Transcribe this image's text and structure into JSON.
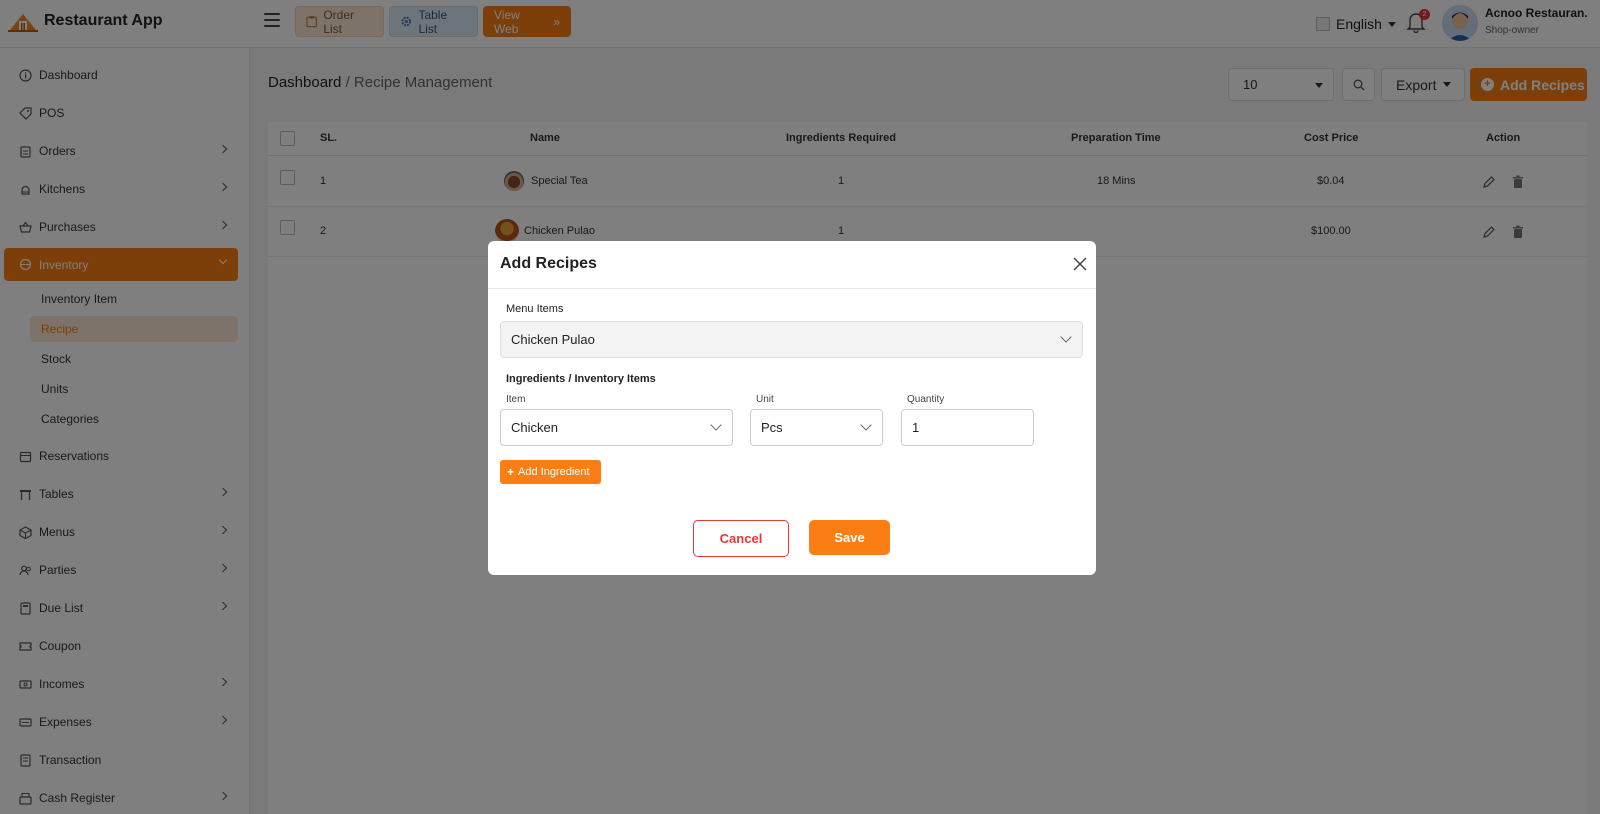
{
  "app": {
    "name": "Restaurant App"
  },
  "topbar": {
    "order_list": "Order List",
    "table_list": "Table List",
    "view_web": "View Web",
    "language": "English",
    "notification_count": "2",
    "user_name": "Acnoo Restauran.",
    "user_role": "Shop-owner"
  },
  "sidebar": {
    "items": [
      {
        "label": "Dashboard",
        "icon": "info-icon"
      },
      {
        "label": "POS",
        "icon": "tag-icon"
      },
      {
        "label": "Orders",
        "icon": "clipboard-icon"
      },
      {
        "label": "Kitchens",
        "icon": "chef-icon"
      },
      {
        "label": "Purchases",
        "icon": "basket-icon"
      },
      {
        "label": "Inventory",
        "icon": "box-icon"
      },
      {
        "label": "Reservations",
        "icon": "calendar-icon"
      },
      {
        "label": "Tables",
        "icon": "table-icon"
      },
      {
        "label": "Menus",
        "icon": "cube-icon"
      },
      {
        "label": "Parties",
        "icon": "users-icon"
      },
      {
        "label": "Due List",
        "icon": "calculator-icon"
      },
      {
        "label": "Coupon",
        "icon": "ticket-icon"
      },
      {
        "label": "Incomes",
        "icon": "income-icon"
      },
      {
        "label": "Expenses",
        "icon": "expense-icon"
      },
      {
        "label": "Transaction",
        "icon": "receipt-icon"
      },
      {
        "label": "Cash Register",
        "icon": "register-icon"
      }
    ],
    "inventory_sub": [
      "Inventory Item",
      "Recipe",
      "Stock",
      "Units",
      "Categories"
    ]
  },
  "main": {
    "breadcrumb_root": "Dashboard",
    "breadcrumb_current": "/ Recipe Management",
    "per_page": "10",
    "export_label": "Export",
    "add_label": "Add Recipes"
  },
  "table": {
    "headers": [
      "SL.",
      "Name",
      "Ingredients Required",
      "Preparation Time",
      "Cost Price",
      "Action"
    ],
    "rows": [
      {
        "sl": "1",
        "name": "Special Tea",
        "ingredients": "1",
        "prep_time": "18 Mins",
        "cost": "$0.04"
      },
      {
        "sl": "2",
        "name": "Chicken Pulao",
        "ingredients": "1",
        "prep_time": "",
        "cost": "$100.00"
      }
    ]
  },
  "modal": {
    "title": "Add Recipes",
    "menu_items_label": "Menu Items",
    "menu_item_value": "Chicken Pulao",
    "ingredients_heading": "Ingredients / Inventory Items",
    "item_label": "Item",
    "item_value": "Chicken",
    "unit_label": "Unit",
    "unit_value": "Pcs",
    "quantity_label": "Quantity",
    "quantity_value": "1",
    "add_ingredient": "Add Ingredient",
    "cancel": "Cancel",
    "save": "Save"
  },
  "colors": {
    "accent": "#fb7e15",
    "danger": "#e53935"
  }
}
